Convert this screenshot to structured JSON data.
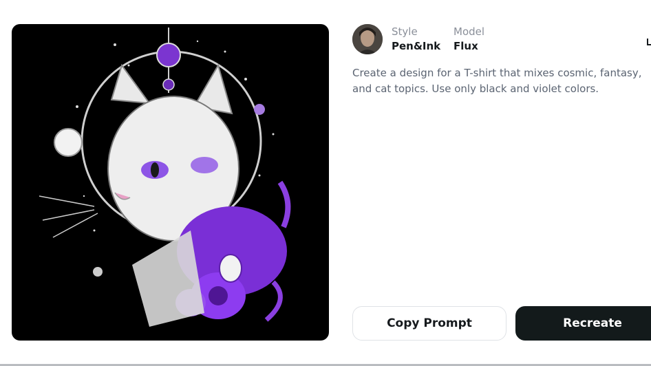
{
  "image": {
    "alt": "Cat with cosmic violet ornaments on black background",
    "colors": {
      "background": "#000000",
      "accent": "#8a3fe0",
      "line": "#e8e8e8"
    }
  },
  "meta": {
    "style_label": "Style",
    "style_value": "Pen&Ink",
    "model_label": "Model",
    "model_value": "Flux"
  },
  "prompt": {
    "text": "Create a design for a T-shirt that mixes cosmic, fantasy, and cat topics. Use only black and violet colors."
  },
  "actions": {
    "copy_label": "Copy Prompt",
    "recreate_label": "Recreate"
  }
}
